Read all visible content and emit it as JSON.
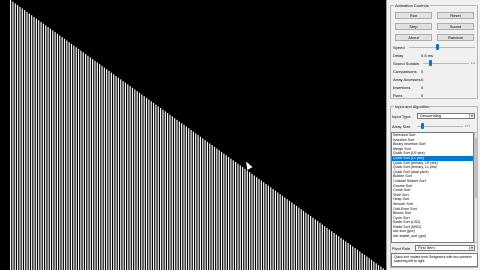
{
  "visualization": {
    "bar_count": 160,
    "order": "descending",
    "bar_color": "#ffffff",
    "background": "#000000"
  },
  "animation": {
    "title": "Animation Controls",
    "run_label": "Run",
    "reset_label": "Reset",
    "step_label": "Step",
    "sound_label": "Sound",
    "about_label": "About",
    "random_label": "Random",
    "speed_label": "Speed",
    "speed_fraction": 0.42,
    "delay_label": "Delay",
    "delay_value": "0.5 ms",
    "sound_sustain_label": "Sound Sustain",
    "sound_sustain_fraction": 0.15,
    "sound_sustain_max": "1.0",
    "comparisons_label": "Comparisons",
    "comparisons_value": "0",
    "array_accesses_label": "Array Accesses",
    "array_accesses_value": "0",
    "insertions_label": "Insertions",
    "insertions_value": "0",
    "runs_label": "Runs",
    "runs_value": "0"
  },
  "input": {
    "title": "Input and Algorithm",
    "input_type_label": "Input Type",
    "input_type_value": "Descending",
    "array_size_label": "Array Size",
    "array_size_fraction": 0.1,
    "array_size_value": "177",
    "algorithms": [
      "Selection Sort",
      "Insertion Sort",
      "Binary Insertion Sort",
      "Merge Sort",
      "Quick Sort (LR ptrs)",
      "Quick Sort (LL ptrs)",
      "Quick Sort (ternary, LR ptrs)",
      "Quick Sort (ternary, LL ptrs)",
      "Quick Sort (dual pivot)",
      "Bubble Sort",
      "Cocktail Shaker Sort",
      "Gnome Sort",
      "Comb Sort",
      "Shell Sort",
      "Heap Sort",
      "Smooth Sort",
      "Odd-Even Sort",
      "Bitonic Sort",
      "Cycle Sort",
      "Radix Sort (LSD)",
      "Radix Sort (MSD)",
      "std::sort (gcc)",
      "std::stable_sort (gcc)"
    ],
    "selected_index": 5,
    "pivot_rule_label": "Pivot Rule",
    "pivot_rule_value": "First Item",
    "description": "Quick sort variant from Sedgewick with two pointers scanning left to right."
  }
}
